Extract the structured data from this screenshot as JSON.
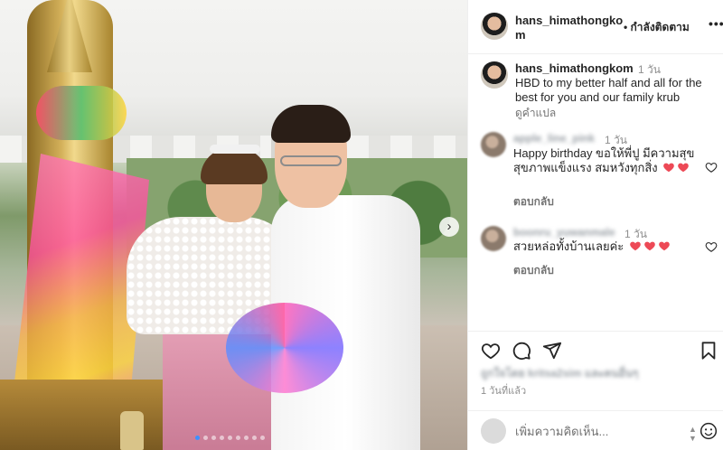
{
  "post": {
    "username": "hans_himathongkom",
    "follow_label": "• กำลังติดตาม",
    "more_label": "•••"
  },
  "caption": {
    "username": "hans_himathongkom",
    "time": "1 วัน",
    "text": "HBD to my better half and all for the best for you and our family krub",
    "translate_label": "ดูคำแปล"
  },
  "comments": [
    {
      "username": "apple_line_pink",
      "time": "1 วัน",
      "text": "Happy birthday ขอให้พี่ปู มีความสุข สุขภาพแข็งแรง สมหวังทุกสิ่ง",
      "hearts": 2,
      "reply_label": "ตอบกลับ"
    },
    {
      "username": "boonru_yuwanmale",
      "time": "1 วัน",
      "text": "สวยหล่อทั้งบ้านเลยค่ะ",
      "hearts": 3,
      "reply_label": "ตอบกลับ"
    }
  ],
  "likes_text": "ถูกใจโดย kritsa2sim และคนอื่นๆ",
  "posted_time": "1 วันที่แล้ว",
  "add_comment": {
    "placeholder": "เพิ่มความคิดเห็น..."
  },
  "carousel": {
    "total_dots": 9,
    "active_index": 0
  },
  "icons": {
    "like": "heart-icon",
    "comment": "comment-bubble-icon",
    "share": "send-icon",
    "save": "bookmark-icon"
  },
  "colors": {
    "heart_red": "#ed4956",
    "carousel_active": "#3d91ff"
  }
}
